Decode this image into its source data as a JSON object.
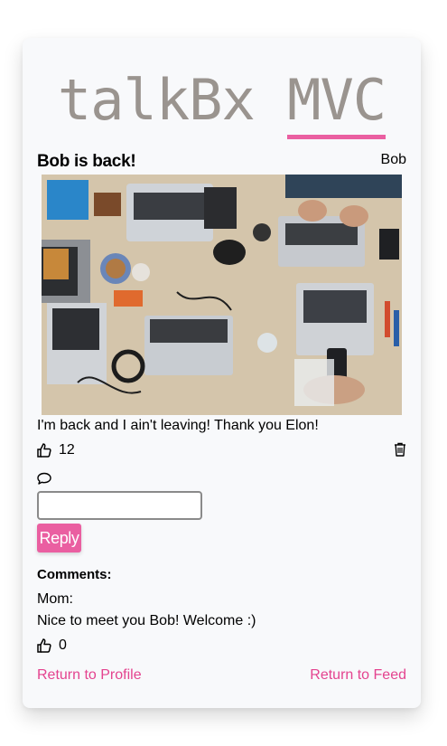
{
  "brand": {
    "part1": "talkBx",
    "part2": "MVC"
  },
  "post": {
    "title": "Bob is back!",
    "author": "Bob",
    "body": "I'm back and I ain't leaving! Thank you Elon!",
    "likes": "12"
  },
  "reply": {
    "input_value": "",
    "button_label": "Reply"
  },
  "comments": {
    "heading": "Comments:",
    "items": [
      {
        "author": "Mom:",
        "text": "Nice to meet you Bob! Welcome :)",
        "likes": "0"
      }
    ]
  },
  "links": {
    "profile": "Return to Profile",
    "feed": "Return to Feed"
  },
  "colors": {
    "accent": "#ea5fa1",
    "brand_text": "#9a948f",
    "card_bg": "#f8f9fb"
  },
  "icons": [
    "thumbs-up-icon",
    "trash-icon",
    "comment-icon"
  ]
}
